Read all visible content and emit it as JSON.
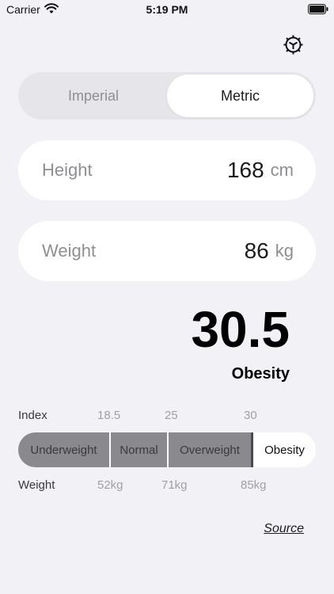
{
  "status_bar": {
    "carrier": "Carrier",
    "time": "5:19 PM"
  },
  "units": {
    "imperial_label": "Imperial",
    "metric_label": "Metric",
    "selected": "Metric"
  },
  "height": {
    "label": "Height",
    "value": "168",
    "unit": "cm"
  },
  "weight": {
    "label": "Weight",
    "value": "86",
    "unit": "kg"
  },
  "result": {
    "bmi": "30.5",
    "category": "Obesity"
  },
  "scale": {
    "index_label": "Index",
    "index_ticks": [
      "18.5",
      "25",
      "30"
    ],
    "categories": [
      "Underweight",
      "Normal",
      "Overweight",
      "Obesity"
    ],
    "weight_label": "Weight",
    "weight_ticks": [
      "52kg",
      "71kg",
      "85kg"
    ],
    "active_category": "Obesity"
  },
  "source_label": "Source",
  "colors": {
    "background": "#f2f2f6",
    "card": "#ffffff",
    "scale_fill": "#8a8a8e",
    "secondary_text": "#8e8e93"
  }
}
